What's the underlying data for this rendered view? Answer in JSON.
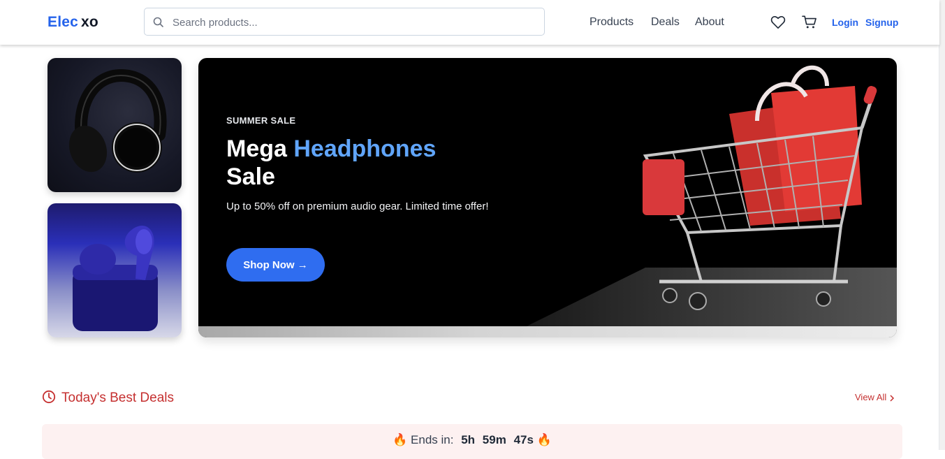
{
  "brand": {
    "part1": "Elec",
    "part2": "xo",
    "color": "#2563eb"
  },
  "search": {
    "placeholder": "Search products..."
  },
  "nav": {
    "items": [
      "Products",
      "Deals",
      "About"
    ]
  },
  "header_icons": [
    "heart-icon",
    "cart-icon"
  ],
  "auth": {
    "login": "Login",
    "signup": "Signup"
  },
  "side_images": [
    "headphones",
    "wireless-earbuds"
  ],
  "hero": {
    "eyebrow": "SUMMER SALE",
    "title_part1": "Mega",
    "title_accent": "Headphones",
    "title_part2": "Sale",
    "description": "Up to 50% off on premium audio gear. Limited time offer!",
    "cta": "Shop Now →",
    "accent_color": "#60a5fa",
    "image": "shopping-cart-with-bags"
  },
  "deals": {
    "title": "Today's Best Deals",
    "view_all": "View All",
    "timer_label": "Ends in:",
    "hours": "5h",
    "minutes": "59m",
    "seconds": "47s",
    "emoji": "🔥",
    "accent_color": "#c53030"
  }
}
